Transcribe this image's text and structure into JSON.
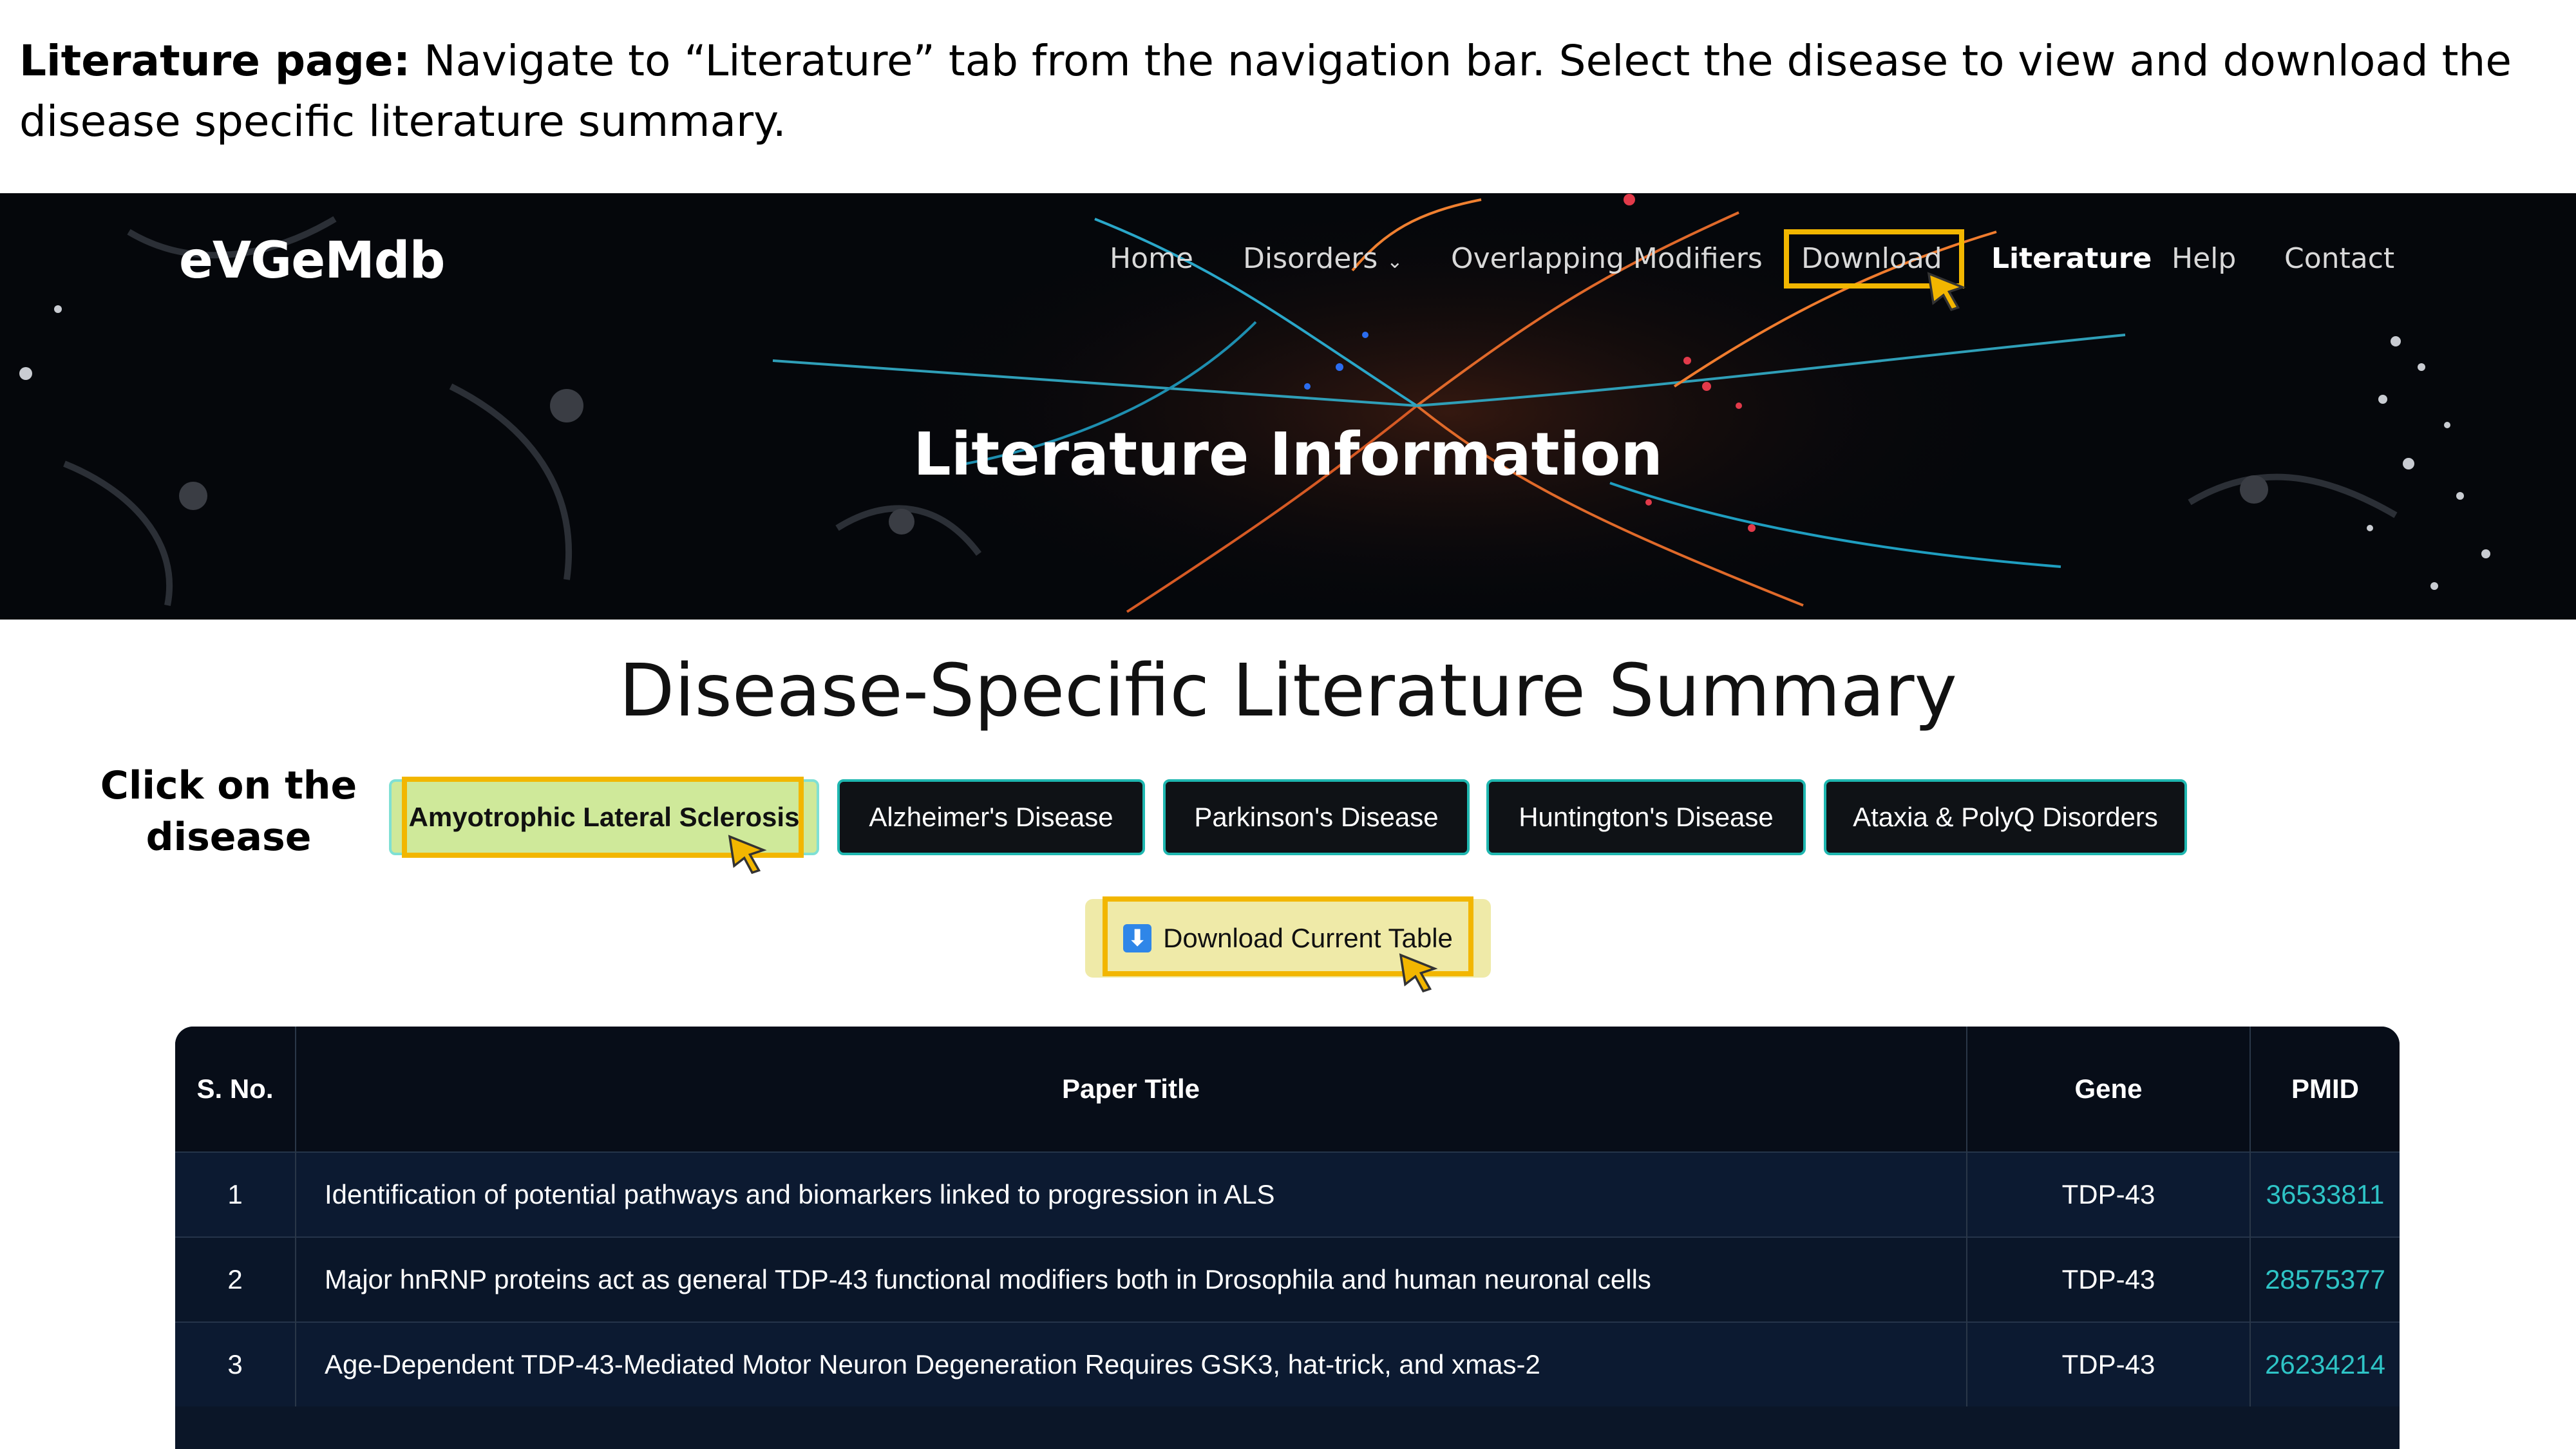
{
  "instruction": {
    "heading": "Literature page:",
    "text": " Navigate to “Literature” tab from the navigation bar. Select the disease to view and download the disease specific literature summary."
  },
  "site": {
    "logo": "eVGeMdb",
    "nav": [
      "Home",
      "Disorders",
      "Overlapping Modifiers",
      "Download",
      "Literature",
      "Help",
      "Contact"
    ],
    "active_nav": "Literature",
    "hero_title": "Literature Information"
  },
  "section": {
    "title": "Disease-Specific Literature Summary",
    "side_note": "Click on the disease",
    "diseases": [
      "Amyotrophic Lateral Sclerosis",
      "Alzheimer's Disease",
      "Parkinson's Disease",
      "Huntington's Disease",
      "Ataxia & PolyQ Disorders"
    ],
    "selected_disease": "Amyotrophic Lateral Sclerosis",
    "download_label": "Download Current Table"
  },
  "table": {
    "headers": [
      "S. No.",
      "Paper Title",
      "Gene",
      "PMID"
    ],
    "rows": [
      [
        "1",
        "Identification of potential pathways and biomarkers linked to progression in ALS",
        "TDP-43",
        "36533811"
      ],
      [
        "2",
        "Major hnRNP proteins act as general TDP-43 functional modifiers both in Drosophila and human neuronal cells",
        "TDP-43",
        "28575377"
      ],
      [
        "3",
        "Age-Dependent TDP-43-Mediated Motor Neuron Degeneration Requires GSK3, hat-trick, and xmas-2",
        "TDP-43",
        "26234214"
      ]
    ]
  },
  "colors": {
    "highlight": "#f2b600",
    "accent": "#1fb7b0",
    "selected_button": "#cfe99a",
    "pmid_link": "#2ec4c6"
  }
}
